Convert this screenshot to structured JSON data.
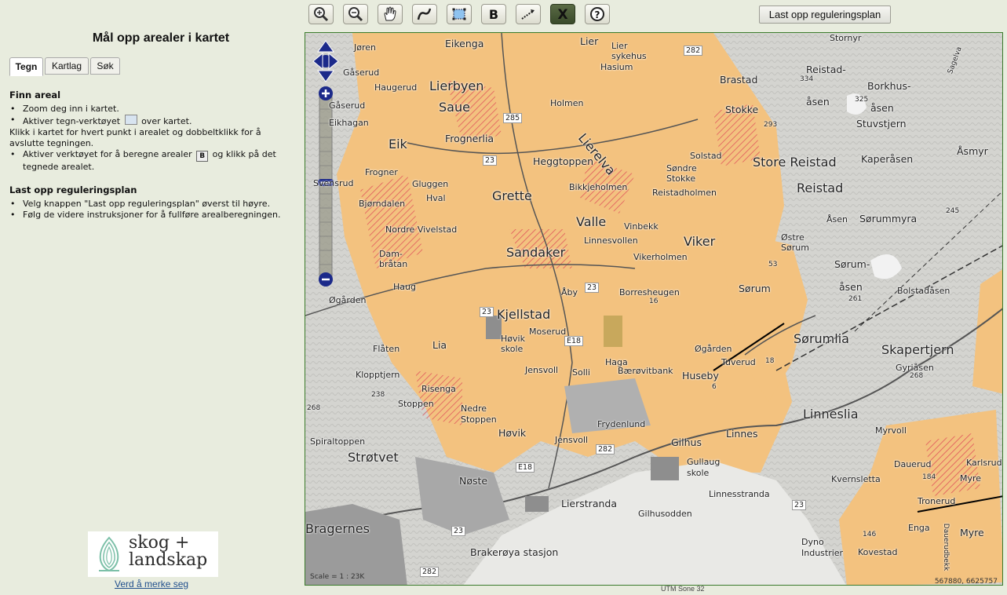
{
  "toolbar": {
    "tools": [
      {
        "name": "zoom-in-tool",
        "icon": "zoom-in-icon"
      },
      {
        "name": "zoom-out-tool",
        "icon": "zoom-out-icon"
      },
      {
        "name": "pan-tool",
        "icon": "hand-icon"
      },
      {
        "name": "draw-line-tool",
        "icon": "curve-icon"
      },
      {
        "name": "draw-polygon-tool",
        "icon": "polygon-icon"
      },
      {
        "name": "calculate-area-tool",
        "icon": "b-icon",
        "label": "B"
      },
      {
        "name": "measure-tool",
        "icon": "measure-icon"
      },
      {
        "name": "clear-tool",
        "icon": "x-icon",
        "label": "X"
      },
      {
        "name": "help-tool",
        "icon": "question-icon",
        "label": "?"
      }
    ],
    "upload_label": "Last opp reguleringsplan"
  },
  "panel": {
    "title": "Mål opp arealer i kartet",
    "tabs": [
      "Tegn",
      "Kartlag",
      "Søk"
    ],
    "active_tab": "Tegn",
    "find_heading": "Finn areal",
    "find_item1": "Zoom deg inn i kartet.",
    "find_item2_a": "Aktiver tegn-verktøyet",
    "find_item2_b": "over kartet.",
    "find_para": "Klikk i kartet for hvert punkt i arealet og dobbeltklikk for å avslutte tegningen.",
    "find_item3_a": "Aktiver verktøyet for å beregne arealer",
    "find_item3_b": "og klikk på det tegnede arealet.",
    "upload_heading": "Last opp reguleringsplan",
    "upload_item1": "Velg knappen \"Last opp reguleringsplan\" øverst til høyre.",
    "upload_item2": "Følg de videre instruksjoner for å fullføre arealberegningen."
  },
  "logo": {
    "line1": "skog +",
    "line2": "landskap",
    "link": "Verd å merke seg"
  },
  "map": {
    "scale": "Scale = 1 : 23K",
    "coords": "567880, 6625757",
    "utm": "UTM Sone 32",
    "places": {
      "p1": "Eikenga",
      "p2": "Lier",
      "p3": "Lier sykehus",
      "p4": "Hasium",
      "p5": "Lierbyen",
      "p6": "Saue",
      "p7": "Haugerud",
      "p8": "Gåserud",
      "p9": "Eik",
      "p10": "Frognerlia",
      "p11": "Holmen",
      "p12": "Heggtoppen",
      "p13": "Lierelva",
      "p14": "Frogner",
      "p15": "Gluggen",
      "p16": "Hval",
      "p17": "Grette",
      "p18": "Bjørndalen",
      "p19": "Nordre Vivelstad",
      "p20": "Sandaker",
      "p21": "Valle",
      "p22": "Linnesvollen",
      "p23": "Vinbekk",
      "p24": "Viker",
      "p25": "Vikerholmen",
      "p26": "Brastad",
      "p27": "Stokke",
      "p28": "Solstad",
      "p29": "Søndre Stokke",
      "p30": "Reistadholmen",
      "p31": "Store Reistad",
      "p32": "Reistad",
      "p33": "Reistad-",
      "p34": "åsen",
      "p35": "Borkhus-",
      "p36": "åsen",
      "p37": "Stuvstjern",
      "p38": "Kaperåsen",
      "p39": "Åsmyr",
      "p40": "Åsen",
      "p41": "Sørummyra",
      "p42": "Østre Sørum",
      "p43": "Sørum-",
      "p44": "åsen",
      "p45": "Sørum",
      "p46": "Bolstadåsen",
      "p47": "Sørumlia",
      "p48": "Skapertjern",
      "p49": "Gyriåsen",
      "p50": "Linneslia",
      "p51": "Øgården",
      "p52": "Tuverud",
      "p53": "Huseby",
      "p54": "Kjellstad",
      "p55": "Høvik skole",
      "p56": "Moserud",
      "p57": "Borresheugen",
      "p58": "Øgården",
      "p59": "Haug",
      "p60": "Lia",
      "p61": "Flåten",
      "p62": "Klopptjern",
      "p63": "Risenga",
      "p64": "Stoppen",
      "p65": "Nedre Stoppen",
      "p66": "Jensvoll",
      "p67": "Solli",
      "p68": "Haga",
      "p69": "Bærøvitbank",
      "p70": "Frydenlund",
      "p71": "Høvik",
      "p72": "Jensvoll",
      "p73": "Spiraltoppen",
      "p74": "Strøtvet",
      "p75": "Nøste",
      "p76": "Lierstranda",
      "p77": "Gilhus",
      "p78": "Gullaug skole",
      "p79": "Linnes",
      "p80": "Linnesstranda",
      "p81": "Gilhusodden",
      "p82": "Bragernes",
      "p83": "Brakerøya stasjon",
      "p84": "Dyno Industrier",
      "p85": "Kovestad",
      "p86": "Myrvoll",
      "p87": "Dauerud",
      "p88": "Kvernsletta",
      "p89": "Tronerud",
      "p90": "Enga",
      "p91": "Myre",
      "p92": "Myre",
      "p93": "Karlsrud",
      "p94": "Dauerudbekk",
      "p95": "Sagelva",
      "p96": "Dam-bråtan",
      "p97": "Bikkjeholmen",
      "p98": "Eikhagan",
      "p99": "Åby",
      "p100": "Stornyr",
      "p101": "Svensrud",
      "p102": "Gåserud",
      "p103": "Jøren"
    },
    "roads": [
      "282",
      "285",
      "23",
      "23",
      "E18",
      "23",
      "282",
      "E18",
      "23",
      "282",
      "23"
    ],
    "heights": [
      "334",
      "325",
      "293",
      "245",
      "261",
      "268",
      "238",
      "268",
      "184",
      "146",
      "16",
      "6",
      "18",
      "53"
    ]
  }
}
